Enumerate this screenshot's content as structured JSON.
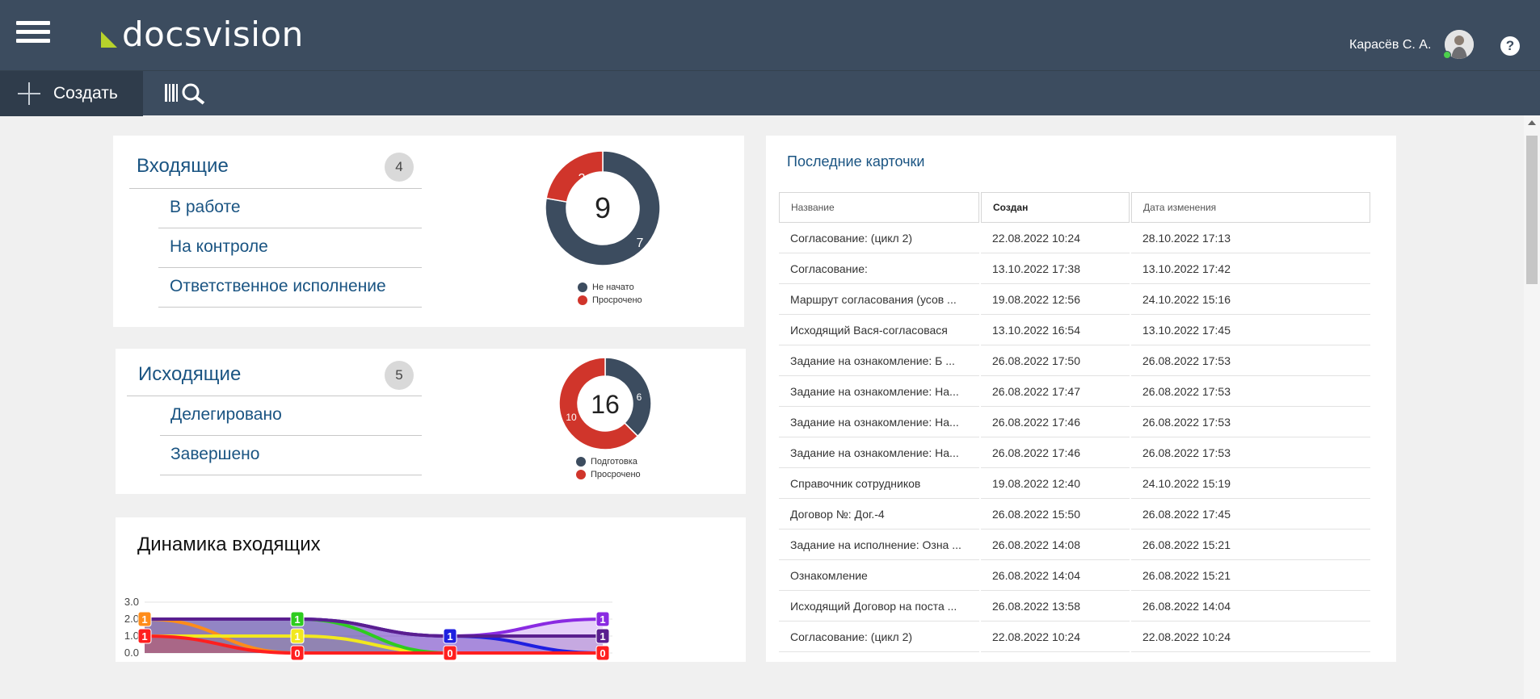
{
  "header": {
    "logo_text": "docsvision",
    "user_name": "Карасёв С. А.",
    "help_symbol": "?",
    "accent": "#3c4c5f"
  },
  "toolbar": {
    "create_label": "Создать",
    "search_icon": "barcode-search-icon"
  },
  "incoming": {
    "title": "Входящие",
    "count": "4",
    "items": [
      "В работе",
      "На контроле",
      "Ответственное исполнение"
    ],
    "donut": {
      "total": "9",
      "segments": [
        {
          "label": "Не начато",
          "value": 7,
          "color": "#3c4c5f"
        },
        {
          "label": "Просрочено",
          "value": 2,
          "color": "#d0352b"
        }
      ]
    }
  },
  "outgoing": {
    "title": "Исходящие",
    "count": "5",
    "items": [
      "Делегировано",
      "Завершено"
    ],
    "donut": {
      "total": "16",
      "segments": [
        {
          "label": "Подготовка",
          "value": 6,
          "color": "#3c4c5f"
        },
        {
          "label": "Просрочено",
          "value": 10,
          "color": "#d0352b"
        }
      ]
    }
  },
  "dynamics": {
    "title": "Динамика  входящих"
  },
  "chart_data": {
    "type": "area",
    "y_ticks": [
      "3.0",
      "2.0",
      "1.0",
      "0.0"
    ],
    "ylim": [
      0,
      3
    ],
    "x": [
      0,
      1,
      2,
      3
    ],
    "series": [
      {
        "color": "#ff8c1a",
        "values": [
          2,
          0,
          0,
          0
        ]
      },
      {
        "color": "#f2e81f",
        "values": [
          1,
          1,
          0,
          0
        ]
      },
      {
        "color": "#2ecc1f",
        "values": [
          2,
          2,
          0,
          0
        ]
      },
      {
        "color": "#1f1fe0",
        "values": [
          2,
          2,
          1,
          0
        ]
      },
      {
        "color": "#8a2be2",
        "values": [
          2,
          2,
          1,
          2
        ]
      },
      {
        "color": "#5a1f8f",
        "values": [
          2,
          2,
          1,
          1
        ]
      },
      {
        "color": "#ff1f1f",
        "values": [
          1,
          0,
          0,
          0
        ]
      }
    ],
    "point_labels": [
      {
        "color": "#ff8c1a",
        "text": "1",
        "x": 0,
        "y": 2
      },
      {
        "color": "#ff1f1f",
        "text": "1",
        "x": 0,
        "y": 1
      },
      {
        "color": "#2ecc1f",
        "text": "1",
        "x": 1,
        "y": 2
      },
      {
        "color": "#f2e81f",
        "text": "1",
        "x": 1,
        "y": 1
      },
      {
        "color": "#ff1f1f",
        "text": "0",
        "x": 1,
        "y": 0
      },
      {
        "color": "#1f1fe0",
        "text": "1",
        "x": 2,
        "y": 1
      },
      {
        "color": "#ff1f1f",
        "text": "0",
        "x": 2,
        "y": 0
      },
      {
        "color": "#8a2be2",
        "text": "1",
        "x": 3,
        "y": 2
      },
      {
        "color": "#5a1f8f",
        "text": "1",
        "x": 3,
        "y": 1
      },
      {
        "color": "#ff1f1f",
        "text": "0",
        "x": 3,
        "y": 0
      }
    ]
  },
  "recent": {
    "title": "Последние карточки",
    "columns": [
      "Название",
      "Создан",
      "Дата изменения"
    ],
    "rows": [
      [
        "Согласование: (цикл 2)",
        "22.08.2022 10:24",
        "28.10.2022 17:13"
      ],
      [
        "Согласование:",
        "13.10.2022 17:38",
        "13.10.2022 17:42"
      ],
      [
        "Маршрут согласования (усов ...",
        "19.08.2022 12:56",
        "24.10.2022 15:16"
      ],
      [
        "Исходящий Вася-согласовася",
        "13.10.2022 16:54",
        "13.10.2022 17:45"
      ],
      [
        "Задание на ознакомление: Б ...",
        "26.08.2022 17:50",
        "26.08.2022 17:53"
      ],
      [
        "Задание на ознакомление: На...",
        "26.08.2022 17:47",
        "26.08.2022 17:53"
      ],
      [
        "Задание на ознакомление: На...",
        "26.08.2022 17:46",
        "26.08.2022 17:53"
      ],
      [
        "Задание на ознакомление: На...",
        "26.08.2022 17:46",
        "26.08.2022 17:53"
      ],
      [
        "Справочник сотрудников",
        "19.08.2022 12:40",
        "24.10.2022 15:19"
      ],
      [
        "Договор №: Дог.-4",
        "26.08.2022 15:50",
        "26.08.2022 17:45"
      ],
      [
        "Задание на исполнение: Озна ...",
        "26.08.2022 14:08",
        "26.08.2022 15:21"
      ],
      [
        "Ознакомление",
        "26.08.2022 14:04",
        "26.08.2022 15:21"
      ],
      [
        "Исходящий Договор на поста ...",
        "26.08.2022 13:58",
        "26.08.2022 14:04"
      ],
      [
        "Согласование: (цикл 2)",
        "22.08.2022 10:24",
        "22.08.2022 10:24"
      ]
    ]
  }
}
